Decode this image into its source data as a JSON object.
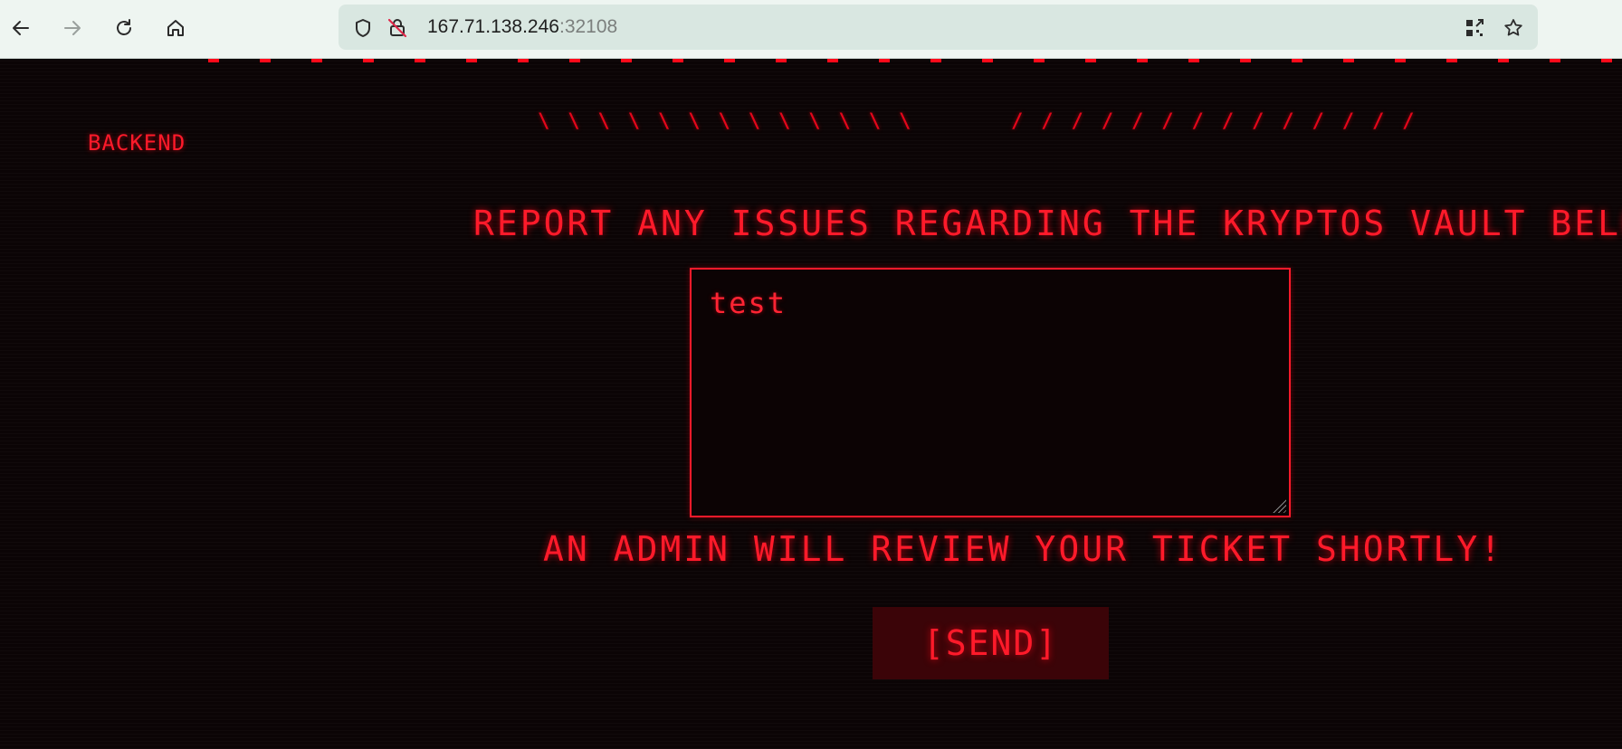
{
  "browser": {
    "url_host": "167.71.138.246",
    "url_port": ":32108",
    "icons": [
      "back-arrow-icon",
      "forward-arrow-icon",
      "reload-icon",
      "home-icon",
      "shield-icon",
      "insecure-lock-icon",
      "qr-code-icon",
      "star-icon"
    ]
  },
  "page": {
    "nav_link": "BACKEND",
    "slashes_left": "\\\\\\\\\\\\\\\\\\\\\\\\\\",
    "slashes_right": "//////////////",
    "heading": "REPORT ANY ISSUES REGARDING THE KRYPTOS VAULT BELOW",
    "ticket_value": "test",
    "notice": "AN ADMIN WILL REVIEW YOUR TICKET SHORTLY!",
    "send_label": "[SEND]"
  },
  "colors": {
    "accent": "#ff1a2a",
    "background": "#0b0405",
    "button_bg": "#3b0408"
  }
}
